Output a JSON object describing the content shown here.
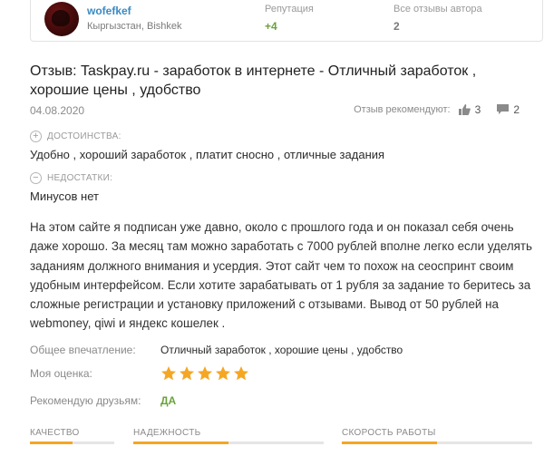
{
  "author": {
    "name": "wofefkef",
    "location": "Кыргызстан, Bishkek",
    "reputation_label": "Репутация",
    "reputation_value": "+4",
    "all_reviews_label": "Все отзывы автора",
    "all_reviews_value": "2"
  },
  "review": {
    "title": "Отзыв: Taskpay.ru - заработок в интернете - Отличный заработок , хорошие цены , удобство",
    "date": "04.08.2020",
    "recommend_label": "Отзыв рекомендуют:",
    "likes": "3",
    "comments": "2"
  },
  "pros": {
    "heading": "ДОСТОИНСТВА:",
    "icon": "+",
    "text": "Удобно , хороший заработок , платит сносно , отличные задания"
  },
  "cons": {
    "heading": "НЕДОСТАТКИ:",
    "icon": "−",
    "text": "Минусов нет"
  },
  "body": "На этом сайте я подписан уже давно, около с прошлого года и он показал себя очень даже хорошо. За месяц там можно заработать с 7000 рублей вполне легко если уделять заданиям должного внимания и усердия. Этот сайт чем то похож на сеоспринт своим удобным интерфейсом. Если хотите зарабатывать от 1 рубля за задание то беритесь за сложные регистрации и установку приложений с отзывами. Вывод от 50 рублей на webmoney, qiwi и яндекс кошелек .",
  "summary": {
    "impression_label": "Общее впечатление:",
    "impression_value": "Отличный заработок , хорошие цены , удобство",
    "rating_label": "Моя оценка:",
    "rating": 5,
    "rating_max": 5,
    "recommend_label": "Рекомендую друзьям:",
    "recommend_value": "ДА"
  },
  "metrics": [
    {
      "label": "КАЧЕСТВО",
      "fill": 0.5
    },
    {
      "label": "НАДЕЖНОСТЬ",
      "fill": 0.5
    },
    {
      "label": "СКОРОСТЬ РАБОТЫ",
      "fill": 0.5
    }
  ],
  "colors": {
    "accent_green": "#6aa23b",
    "star": "#f5a623",
    "link_blue": "#3a8ac2"
  }
}
